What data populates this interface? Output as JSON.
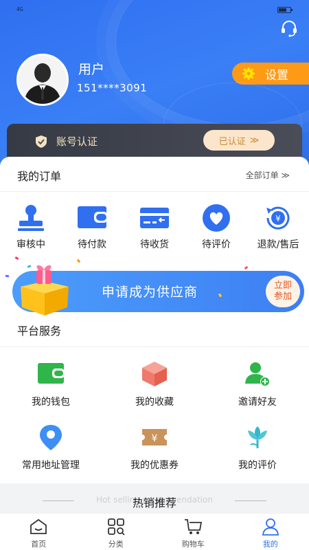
{
  "status": {
    "signal": "4G"
  },
  "profile": {
    "name": "用户",
    "phone": "151****3091",
    "settings_label": "设置"
  },
  "verify": {
    "label": "账号认证",
    "badge": "已认证",
    "badge_chevron": "≫"
  },
  "orders": {
    "title": "我的订单",
    "all_label": "全部订单 ≫",
    "items": [
      {
        "label": "审核中",
        "icon": "stamp-icon"
      },
      {
        "label": "待付款",
        "icon": "wallet-icon"
      },
      {
        "label": "待收货",
        "icon": "card-receive-icon"
      },
      {
        "label": "待评价",
        "icon": "heart-icon"
      },
      {
        "label": "退款/售后",
        "icon": "refund-icon"
      }
    ]
  },
  "banner": {
    "text": "申请成为供应商",
    "button_line1": "立即",
    "button_line2": "参加"
  },
  "services": {
    "title": "平台服务",
    "items": [
      {
        "label": "我的钱包",
        "icon": "wallet-icon"
      },
      {
        "label": "我的收藏",
        "icon": "box-icon"
      },
      {
        "label": "邀请好友",
        "icon": "add-friend-icon"
      },
      {
        "label": "常用地址管理",
        "icon": "location-pin-icon"
      },
      {
        "label": "我的优惠券",
        "icon": "coupon-icon"
      },
      {
        "label": "我的评价",
        "icon": "flower-icon"
      }
    ]
  },
  "hot": {
    "title": "热销推荐",
    "subtitle": "Hot selling recommendation"
  },
  "tabs": [
    {
      "label": "首页",
      "icon": "home-icon"
    },
    {
      "label": "分类",
      "icon": "category-icon"
    },
    {
      "label": "购物车",
      "icon": "cart-icon"
    },
    {
      "label": "我的",
      "icon": "profile-icon"
    }
  ],
  "colors": {
    "primary": "#2f6ff0",
    "accent": "#ff9a16",
    "green": "#2fb54a",
    "coral": "#ef7a6c"
  }
}
